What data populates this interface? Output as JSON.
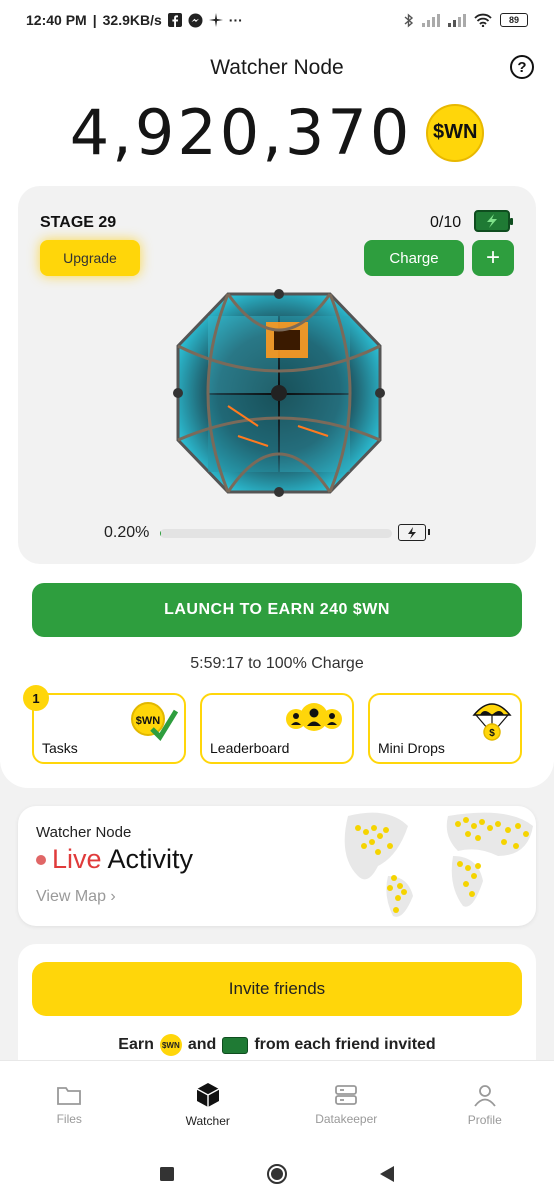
{
  "status_bar": {
    "time": "12:40 PM",
    "speed": "32.9KB/s",
    "battery": "89"
  },
  "header": {
    "title": "Watcher Node"
  },
  "balance": {
    "value": "4,920,370",
    "coin_label": "$WN"
  },
  "stage_card": {
    "stage": "STAGE 29",
    "charges": "0/10",
    "upgrade_label": "Upgrade",
    "charge_label": "Charge",
    "plus_label": "+",
    "progress_text": "0.20%",
    "progress_fraction": 0.002
  },
  "launch": {
    "label": "LAUNCH TO EARN 240 $WN"
  },
  "timer": {
    "text": "5:59:17 to 100% Charge"
  },
  "quick_actions": {
    "badge": "1",
    "tasks": "Tasks",
    "leaderboard": "Leaderboard",
    "mini_drops": "Mini Drops",
    "tasks_coin": "$WN"
  },
  "live_activity": {
    "subtitle": "Watcher Node",
    "live_word": "Live",
    "activity_word": "Activity",
    "view_map": "View Map"
  },
  "invite": {
    "button": "Invite friends",
    "earn_prefix": "Earn",
    "earn_and": "and",
    "earn_suffix": "from each friend invited",
    "coin": "$WN"
  },
  "bottom_nav": {
    "files": "Files",
    "watcher": "Watcher",
    "datakeeper": "Datakeeper",
    "profile": "Profile"
  },
  "colors": {
    "accent_yellow": "#ffd60a",
    "accent_green": "#2e9e3e",
    "live_red": "#e03b3b"
  }
}
